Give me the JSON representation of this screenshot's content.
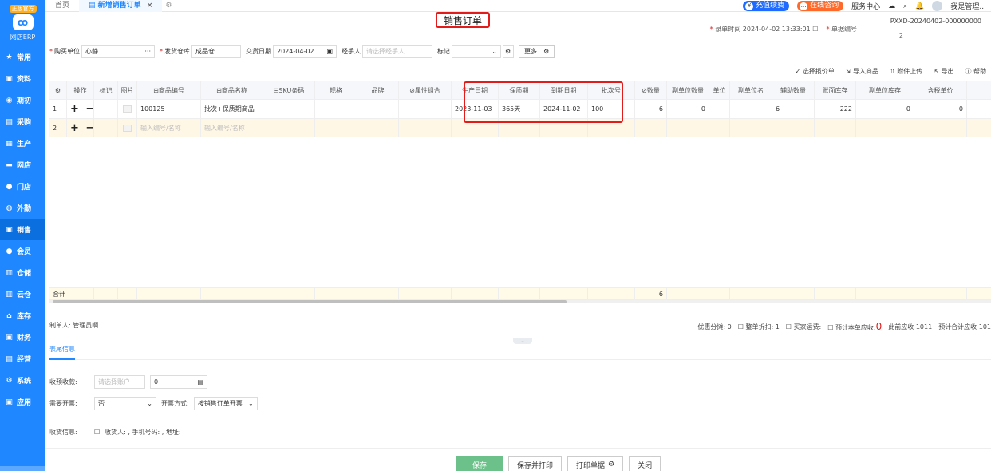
{
  "sidebar": {
    "logo_badge": "正版官方",
    "logo_text": "网店ERP",
    "items": [
      {
        "label": "常用",
        "icon": "★"
      },
      {
        "label": "资料",
        "icon": "▣"
      },
      {
        "label": "期初",
        "icon": "◉"
      },
      {
        "label": "采购",
        "icon": "▤"
      },
      {
        "label": "生产",
        "icon": "▦"
      },
      {
        "label": "网店",
        "icon": "▬"
      },
      {
        "label": "门店",
        "icon": "●"
      },
      {
        "label": "外勤",
        "icon": "◍"
      },
      {
        "label": "销售",
        "icon": "▣"
      },
      {
        "label": "会员",
        "icon": "●"
      },
      {
        "label": "仓储",
        "icon": "▥"
      },
      {
        "label": "云仓",
        "icon": "▥"
      },
      {
        "label": "库存",
        "icon": "⌂"
      },
      {
        "label": "财务",
        "icon": "▣"
      },
      {
        "label": "经营",
        "icon": "▤"
      },
      {
        "label": "系统",
        "icon": "⚙"
      },
      {
        "label": "应用",
        "icon": "▣"
      }
    ]
  },
  "tabs": {
    "home": "首页",
    "active": "新增销售订单",
    "close": "×"
  },
  "top_right": {
    "renew": "充值续费",
    "consult": "在线咨询",
    "service": "服务中心",
    "user": "我是管理..."
  },
  "header": {
    "title": "销售订单",
    "entry_time_label": "录单时间",
    "entry_time": "2024-04-02 13:33:01",
    "order_no_label": "单据编号",
    "order_no": "PXXD-20240402-000000000",
    "order_no_suffix": "2"
  },
  "form": {
    "buyer_label": "购买单位",
    "buyer_value": "心静",
    "buyer_more": "···",
    "warehouse_label": "发货仓库",
    "warehouse_value": "成品仓",
    "date_label": "交货日期",
    "date_value": "2024-04-02",
    "handler_label": "经手人",
    "handler_placeholder": "请选择经手人",
    "tag_label": "标记",
    "more_label": "更多.."
  },
  "toolbar": {
    "select_quote": "选择报价单",
    "import_goods": "导入商品",
    "attach_upload": "附件上传",
    "export": "导出",
    "help": "帮助"
  },
  "table": {
    "columns": [
      "",
      "操作",
      "标记",
      "图片",
      "商品编号",
      "商品名称",
      "SKU条码",
      "规格",
      "品牌",
      "属性组合",
      "生产日期",
      "保质期",
      "到期日期",
      "批次号",
      "数量",
      "副单位数量",
      "单位",
      "副单位名",
      "辅助数量",
      "账面库存",
      "副单位库存",
      "含税单价"
    ],
    "rows": [
      [
        "1",
        "+ −",
        "",
        "",
        "100125",
        "批次+保质期商品",
        "",
        "",
        "",
        "",
        "2023-11-03",
        "365天",
        "2024-11-02",
        "100",
        "6",
        "0",
        "",
        "",
        "6",
        "222",
        "0",
        "0"
      ],
      [
        "2",
        "+ −",
        "",
        "",
        "输入编号/名称",
        "输入编号/名称",
        "",
        "",
        "",
        "",
        "",
        "",
        "",
        "",
        "",
        "",
        "",
        "",
        "",
        "",
        "",
        ""
      ]
    ],
    "footer_label": "合计",
    "footer_qty": "6"
  },
  "summary": {
    "creator": "制单人: 管理员啊",
    "discount_label": "优惠分摊:",
    "discount_value": "0",
    "whole_discount_label": "整单折扣:",
    "whole_discount_value": "1",
    "shipping_label": "买家运费:",
    "receivable_label": "预计本单应收:",
    "receivable_value": "0",
    "prev_receivable": "此前应收 1011",
    "total_receivable": "预计合计应收 101"
  },
  "footer_tabs": {
    "tail_info": "表尾信息"
  },
  "tail": {
    "prepay_label": "收预收款:",
    "prepay_account_placeholder": "请选择账户",
    "prepay_amount": "0",
    "invoice_label": "需要开票:",
    "invoice_value": "否",
    "invoice_method_label": "开票方式:",
    "invoice_method_value": "按销售订单开票",
    "receipt_label": "收货信息:",
    "receipt_value": "收货人: , 手机号码: , 地址:"
  },
  "buttons": {
    "save": "保存",
    "save_print": "保存并打印",
    "print": "打印单据",
    "close": "关闭"
  }
}
